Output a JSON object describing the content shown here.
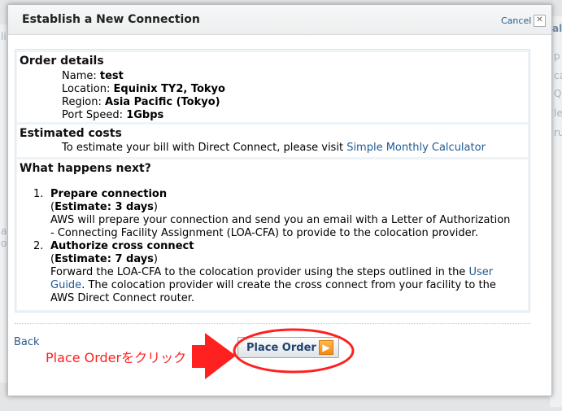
{
  "background_fragments": [
    {
      "text": "al"
    },
    {
      "text": "li"
    },
    {
      "text": "p"
    },
    {
      "text": "ca"
    },
    {
      "text": "Q"
    },
    {
      "text": "le"
    },
    {
      "text": "ru"
    },
    {
      "text": "a"
    },
    {
      "text": "o"
    }
  ],
  "dialog": {
    "title": "Establish a New Connection",
    "cancel_label": "Cancel",
    "close_glyph": "✕"
  },
  "order_details": {
    "title": "Order details",
    "name_label": "Name:",
    "name_value": "test",
    "location_label": "Location:",
    "location_value": "Equinix TY2, Tokyo",
    "region_label": "Region:",
    "region_value": "Asia Pacific (Tokyo)",
    "port_speed_label": "Port Speed:",
    "port_speed_value": "1Gbps"
  },
  "estimated_costs": {
    "title": "Estimated costs",
    "text": "To estimate your bill with Direct Connect, please visit",
    "link": "Simple Monthly Calculator"
  },
  "what_next": {
    "title": "What happens next?",
    "steps": [
      {
        "num": "1.",
        "title": "Prepare connection",
        "estimate": "Estimate: 3 days",
        "line1": "AWS will prepare your connection and send you an email with a Letter of Authorization",
        "line2": "- Connecting Facility Assignment (LOA-CFA) to provide to the colocation provider."
      },
      {
        "num": "2.",
        "title": "Authorize cross connect",
        "estimate": "Estimate: 7 days",
        "line1_pre": "Forward the LOA-CFA to the colocation provider using the steps outlined in the",
        "link_part1": "User",
        "link_part2": "Guide",
        "line2_post": ". The colocation provider will create the cross connect from your facility to the",
        "line3": "AWS Direct Connect router."
      }
    ]
  },
  "footer": {
    "back_label": "Back",
    "place_order_label": "Place Order",
    "arrow_glyph": "▶"
  },
  "annotation": {
    "text": "Place Orderをクリック",
    "color": "#ff2020"
  }
}
